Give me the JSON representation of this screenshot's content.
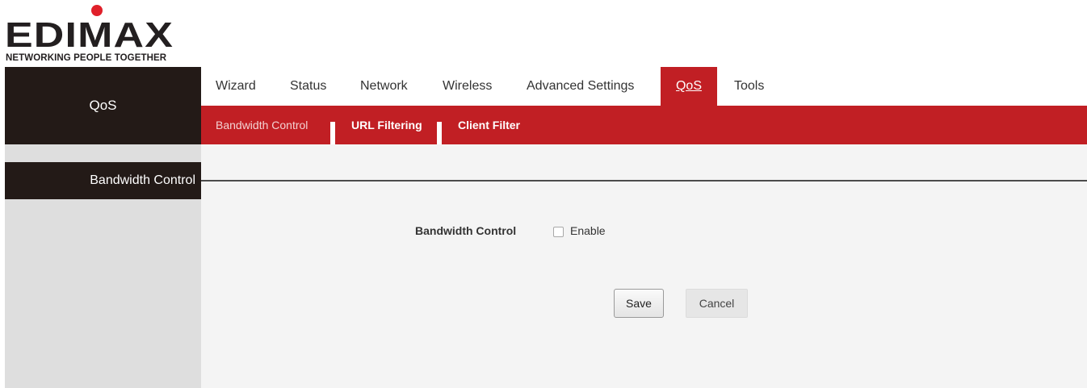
{
  "logo": {
    "text": "EDIMAX",
    "tagline": "NETWORKING PEOPLE TOGETHER",
    "dot_color": "#e0202a"
  },
  "sidebar": {
    "header": "QoS",
    "items": [
      {
        "label": "Bandwidth Control",
        "active": true
      }
    ]
  },
  "main_nav": {
    "tabs": [
      {
        "label": "Wizard"
      },
      {
        "label": "Status"
      },
      {
        "label": "Network"
      },
      {
        "label": "Wireless"
      },
      {
        "label": "Advanced Settings"
      },
      {
        "label": "QoS",
        "active": true
      },
      {
        "label": "Tools"
      }
    ]
  },
  "sub_nav": {
    "tabs": [
      {
        "label": "Bandwidth Control",
        "active": true
      },
      {
        "label": "URL Filtering"
      },
      {
        "label": "Client Filter"
      }
    ]
  },
  "form": {
    "field_label": "Bandwidth Control",
    "enable_label": "Enable",
    "enable_checked": false
  },
  "buttons": {
    "save": "Save",
    "cancel": "Cancel"
  },
  "colors": {
    "accent_red": "#c11f24",
    "sidebar_dark": "#231a17",
    "sidebar_bg": "#dedede",
    "content_bg": "#f4f4f4"
  }
}
